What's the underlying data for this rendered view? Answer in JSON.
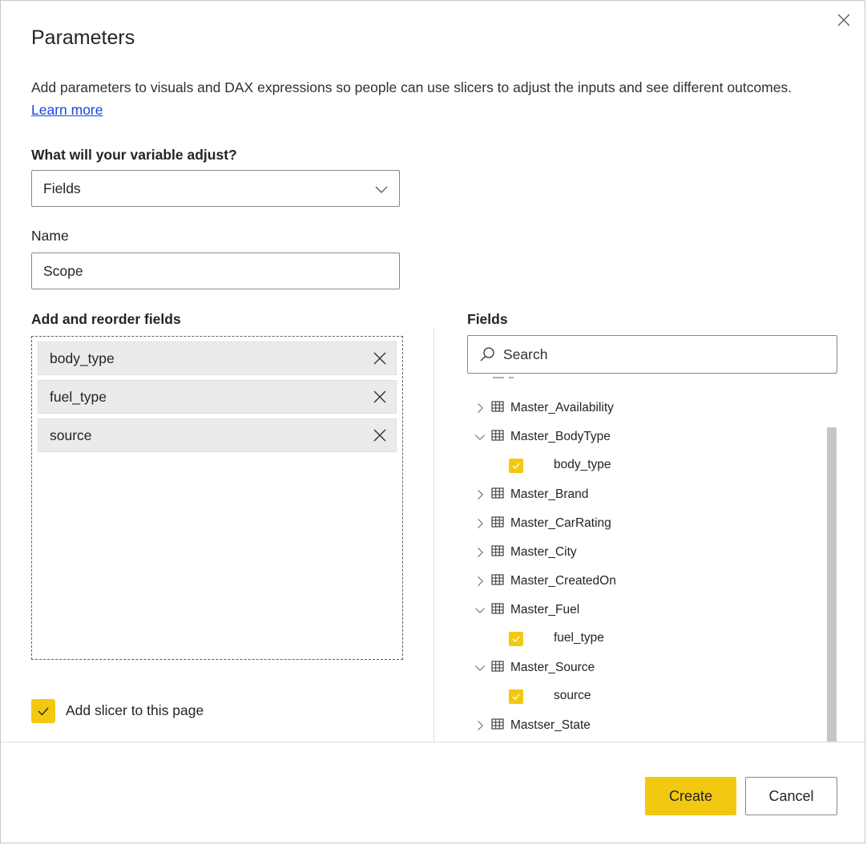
{
  "dialog": {
    "title": "Parameters",
    "description": "Add parameters to visuals and DAX expressions so people can use slicers to adjust the inputs and see different outcomes.",
    "learn_more": "Learn more"
  },
  "variable": {
    "label": "What will your variable adjust?",
    "selected": "Fields"
  },
  "name": {
    "label": "Name",
    "value": "Scope"
  },
  "reorder": {
    "label": "Add and reorder fields",
    "items": [
      "body_type",
      "fuel_type",
      "source"
    ]
  },
  "slicer": {
    "label": "Add slicer to this page",
    "checked": true
  },
  "fields_panel": {
    "label": "Fields",
    "search_placeholder": "Search",
    "rows": [
      {
        "type": "table",
        "label": "Master_Availability",
        "expanded": false
      },
      {
        "type": "table",
        "label": "Master_BodyType",
        "expanded": true
      },
      {
        "type": "field",
        "label": "body_type",
        "checked": true
      },
      {
        "type": "table",
        "label": "Master_Brand",
        "expanded": false
      },
      {
        "type": "table",
        "label": "Master_CarRating",
        "expanded": false
      },
      {
        "type": "table",
        "label": "Master_City",
        "expanded": false
      },
      {
        "type": "table",
        "label": "Master_CreatedOn",
        "expanded": false
      },
      {
        "type": "table",
        "label": "Master_Fuel",
        "expanded": true
      },
      {
        "type": "field",
        "label": "fuel_type",
        "checked": true
      },
      {
        "type": "table",
        "label": "Master_Source",
        "expanded": true
      },
      {
        "type": "field",
        "label": "source",
        "checked": true
      },
      {
        "type": "table",
        "label": "Mastser_State",
        "expanded": false
      }
    ]
  },
  "buttons": {
    "create": "Create",
    "cancel": "Cancel"
  },
  "colors": {
    "accent": "#f2c811",
    "link": "#1a47d6"
  }
}
